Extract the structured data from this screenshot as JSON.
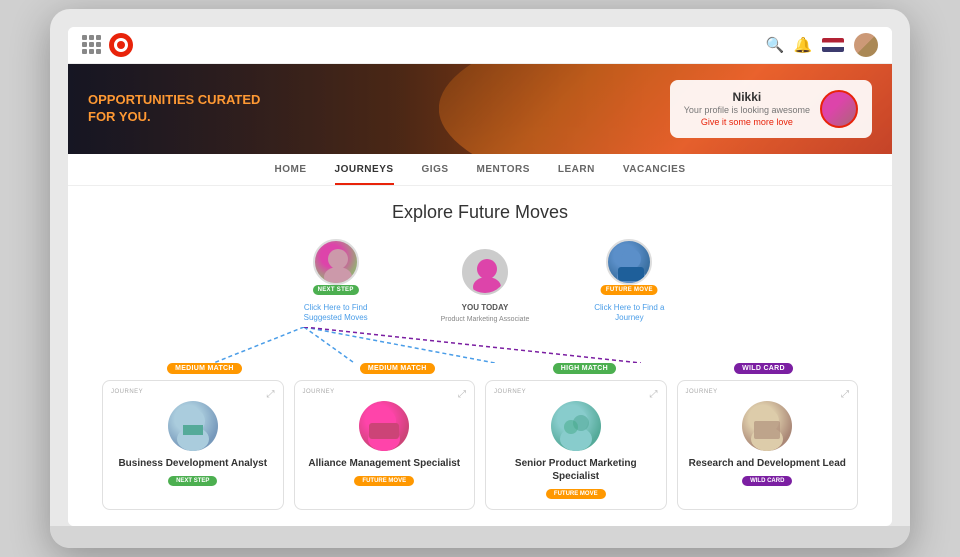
{
  "topbar": {
    "logo_alt": "Company Logo"
  },
  "hero": {
    "title_line1": "OPPORTUNITIES CURATED",
    "title_line2": "FOR YOU.",
    "profile_name": "Nikki",
    "profile_subtitle": "Your profile is looking awesome",
    "profile_link": "Give it some more love"
  },
  "nav": {
    "items": [
      {
        "label": "HOME",
        "active": false
      },
      {
        "label": "JOURNEYS",
        "active": true
      },
      {
        "label": "GIGS",
        "active": false
      },
      {
        "label": "MENTORS",
        "active": false
      },
      {
        "label": "LEARN",
        "active": false
      },
      {
        "label": "VACANCIES",
        "active": false
      }
    ]
  },
  "main": {
    "page_title": "Explore Future Moves",
    "flow": {
      "node_left": {
        "badge": "NEXT STEP",
        "link_label": "Click Here to Find Suggested Moves"
      },
      "node_center": {
        "you_label": "YOU TODAY",
        "you_sub": "Product Marketing Associate"
      },
      "node_right": {
        "badge": "FUTURE MOVE",
        "link_label": "Click Here to Find a Journey"
      }
    },
    "cards": [
      {
        "top_label": "JOURNEY",
        "title": "Business Development Analyst",
        "badge": "NEXT STEP",
        "badge_type": "green",
        "match": "MEDIUM MATCH",
        "match_type": "medium"
      },
      {
        "top_label": "JOURNEY",
        "title": "Alliance Management Specialist",
        "badge": "FUTURE MOVE",
        "badge_type": "orange",
        "match": "MEDIUM MATCH",
        "match_type": "medium"
      },
      {
        "top_label": "JOURNEY",
        "title": "Senior Product Marketing Specialist",
        "badge": "FUTURE MOVE",
        "badge_type": "orange",
        "match": "HIGH MATCH",
        "match_type": "high"
      },
      {
        "top_label": "JOURNEY",
        "title": "Research and Development Lead",
        "badge": "WILD CARD",
        "badge_type": "purple",
        "match": "WILD CARD",
        "match_type": "wild"
      }
    ],
    "match_labels": [
      "MEDIUM MATCH",
      "MEDIUM MATCH",
      "HIGH MATCH",
      "WILD CARD"
    ]
  }
}
